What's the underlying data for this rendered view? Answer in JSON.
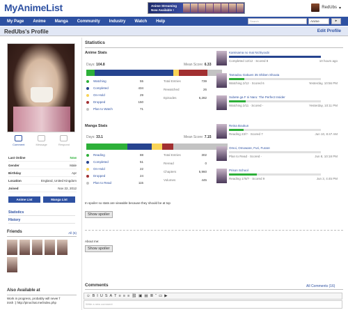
{
  "header": {
    "logo": "MyAnimeList",
    "banner_line1": "Anime Streaming",
    "banner_line2": "Now Available !",
    "username": "RedUbs",
    "user_caret": "▾"
  },
  "nav": {
    "items": [
      "My Page",
      "Anime",
      "Manga",
      "Community",
      "Industry",
      "Watch",
      "Help"
    ],
    "search_placeholder": "Search",
    "search_type": "Anime",
    "go_label": "▸"
  },
  "profile": {
    "title": "RedUbs's Profile",
    "edit_label": "Edit Profile",
    "actions": [
      "Comment",
      "Message",
      "Respond"
    ],
    "info": [
      {
        "key": "Last Online",
        "value": "Now",
        "green": true
      },
      {
        "key": "Gender",
        "value": "Male"
      },
      {
        "key": "Birthday",
        "value": "Apr"
      },
      {
        "key": "Location",
        "value": "England, United Kingdom"
      },
      {
        "key": "Joined",
        "value": "Nov 22, 2012"
      }
    ],
    "anime_list_btn": "Anime List",
    "manga_list_btn": "Manga List",
    "links": [
      "Statistics",
      "History"
    ],
    "friends_label": "Friends",
    "friends_all": "All (6)",
    "also_label": "Also Available at",
    "also_text_1": "Work in progress, probably will never f",
    "also_text_2": "inish :) http://pinochat.me/index.php"
  },
  "stats": {
    "title": "Statistics",
    "anime": {
      "label": "Anime Stats",
      "days_label": "Days:",
      "days_value": "104.8",
      "mean_label": "Mean Score:",
      "mean_value": "6.33",
      "bar": [
        {
          "color": "#2db039",
          "fraction": 0.06
        },
        {
          "color": "#26448f",
          "fraction": 0.55
        },
        {
          "color": "#f9d457",
          "fraction": 0.04
        },
        {
          "color": "#a12f31",
          "fraction": 0.2
        },
        {
          "color": "#c3c3c3",
          "fraction": 0.1
        }
      ],
      "legend": [
        {
          "label": "Watching",
          "value": "55",
          "color": "#2db039"
        },
        {
          "label": "Completed",
          "value": "434",
          "color": "#26448f"
        },
        {
          "label": "On-Hold",
          "value": "29",
          "color": "#f9d457"
        },
        {
          "label": "Dropped",
          "value": "150",
          "color": "#a12f31"
        },
        {
          "label": "Plan to Watch",
          "value": "71",
          "color": "#c3c3c3"
        }
      ],
      "totals": [
        {
          "label": "Total Entries",
          "value": "739"
        },
        {
          "label": "Rewatched",
          "value": "26"
        },
        {
          "label": "Episodes",
          "value": "6,282"
        }
      ]
    },
    "manga": {
      "label": "Manga Stats",
      "days_label": "Days:",
      "days_value": "33.1",
      "mean_label": "Mean Score:",
      "mean_value": "7.15",
      "bar": [
        {
          "color": "#2db039",
          "fraction": 0.29
        },
        {
          "color": "#26448f",
          "fraction": 0.17
        },
        {
          "color": "#f9d457",
          "fraction": 0.07
        },
        {
          "color": "#a12f31",
          "fraction": 0.08
        },
        {
          "color": "#c3c3c3",
          "fraction": 0.38
        }
      ],
      "legend": [
        {
          "label": "Reading",
          "value": "88",
          "color": "#2db039"
        },
        {
          "label": "Completed",
          "value": "51",
          "color": "#26448f"
        },
        {
          "label": "On-Hold",
          "value": "22",
          "color": "#f9d457"
        },
        {
          "label": "Dropped",
          "value": "24",
          "color": "#a12f31"
        },
        {
          "label": "Plan to Read",
          "value": "115",
          "color": "#c3c3c3"
        }
      ],
      "totals": [
        {
          "label": "Total Entries",
          "value": "302"
        },
        {
          "label": "Reread",
          "value": "0"
        },
        {
          "label": "Chapters",
          "value": "5,960"
        },
        {
          "label": "Volumes",
          "value": "445"
        }
      ]
    }
  },
  "updates": {
    "anime": [
      {
        "title": "Kamisama no Inai Nichiyoubi",
        "progress": 1.0,
        "color": "#26448f",
        "status": "Completed 12/12 · Scored 8",
        "time": "10 hours ago"
      },
      {
        "title": "Tamadou Gakuen 35 Shiken Shouta",
        "progress": 0.17,
        "color": "#2db039",
        "status": "Watching 2/12 · Scored 6",
        "time": "Yesterday, 10:56 PM"
      },
      {
        "title": "Subete ga F ni Naru: The Perfect Insider",
        "progress": 0.18,
        "color": "#2db039",
        "status": "Watching 2/11 · Scored -",
        "time": "Yesterday, 10:11 PM"
      }
    ],
    "manga": [
      {
        "title": "Reina Boukun",
        "progress": 0.16,
        "color": "#2db039",
        "status": "Reading 23/? · Scored 7",
        "time": "Jun 10, 8:47 AM"
      },
      {
        "title": "Omoi, Omoware, Furi, Furare",
        "progress": 0.0,
        "color": "#c3c3c3",
        "status": "Plan to Read · Scored -",
        "time": "Jun 8, 10:18 PM"
      },
      {
        "title": "Prison School",
        "progress": 0.3,
        "color": "#2db039",
        "status": "Reading 178/? · Scored 9",
        "time": "Jun 3, 4:45 PM"
      }
    ]
  },
  "about": {
    "spoiler_note": "In spoiler so stats are viewable because they should be at top",
    "show_spoiler": "Show spoiler",
    "about_label": "About me:",
    "show_spoiler_2": "Show spoiler"
  },
  "comments": {
    "label": "Comments",
    "all": "All Comments (16)",
    "placeholder": "Write a new comment",
    "tools": [
      "☺",
      "B",
      "I",
      "U",
      "S",
      "A",
      "T",
      "≡",
      "≡",
      "≡",
      "⛓",
      "▣",
      "▤",
      "≣",
      "“",
      "▭",
      "▶"
    ]
  }
}
